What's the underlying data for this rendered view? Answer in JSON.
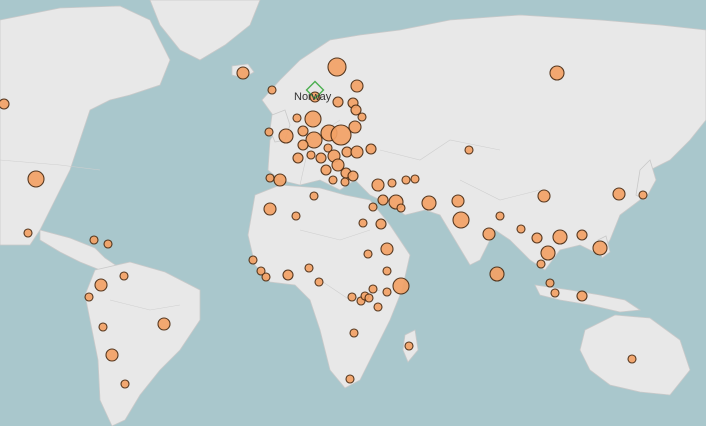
{
  "map": {
    "highlight_label": "Norway",
    "colors": {
      "ocean": "#a9c7cc",
      "land": "#e8e8e8",
      "bubble_fill": "#f3a266",
      "bubble_stroke": "#4a2a10",
      "highlight_marker": "#4caf50"
    },
    "marker_icon": "diamond-outline-icon"
  }
}
